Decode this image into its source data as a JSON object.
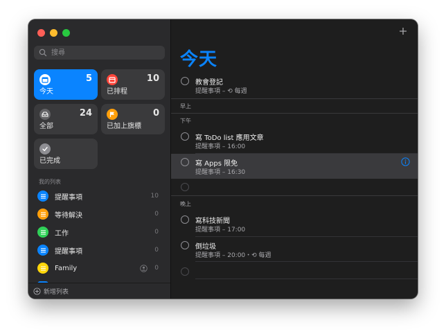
{
  "window": {
    "traffic_lights": [
      "close",
      "minimize",
      "zoom"
    ]
  },
  "sidebar": {
    "search": {
      "placeholder": "搜尋"
    },
    "smart_lists": [
      {
        "label": "今天",
        "count": "5",
        "color": "#0a84ff",
        "icon": "calendar-today-icon",
        "active": true
      },
      {
        "label": "已排程",
        "count": "10",
        "color": "#ff453a",
        "icon": "calendar-icon",
        "active": false
      },
      {
        "label": "全部",
        "count": "24",
        "color": "#636366",
        "icon": "tray-icon",
        "active": false
      },
      {
        "label": "已加上旗標",
        "count": "0",
        "color": "#ff9f0a",
        "icon": "flag-icon",
        "active": false
      },
      {
        "label": "已完成",
        "count": "",
        "color": "#8e8e93",
        "icon": "checkmark-icon",
        "active": false
      }
    ],
    "my_lists_label": "我的列表",
    "lists": [
      {
        "name": "提醒事項",
        "count": "10",
        "color": "#0a84ff",
        "icon": "list-bullet-icon"
      },
      {
        "name": "等待解決",
        "count": "0",
        "color": "#ff9f0a",
        "icon": "list-bullet-icon"
      },
      {
        "name": "工作",
        "count": "0",
        "color": "#30d158",
        "icon": "list-bullet-icon"
      },
      {
        "name": "提醒事項",
        "count": "0",
        "color": "#0a84ff",
        "icon": "list-bullet-icon"
      },
      {
        "name": "Family",
        "count": "0",
        "color": "#ffd60a",
        "icon": "list-bullet-icon",
        "shared": true
      }
    ],
    "add_list_label": "新增列表"
  },
  "main": {
    "title": "今天",
    "add_icon": "plus-icon",
    "items_top": [
      {
        "title": "教會登記",
        "subtitle": "提醒事項 – ⟲ 每週"
      }
    ],
    "groups": {
      "morning": "早上",
      "afternoon": "下午",
      "evening": "晚上"
    },
    "afternoon_items": [
      {
        "title": "寫 ToDo list 應用文章",
        "subtitle": "提醒事項 – 16:00"
      },
      {
        "title": "寫 Apps 限免",
        "subtitle": "提醒事項 – 16:30"
      }
    ],
    "evening_items": [
      {
        "title": "寫科技新聞",
        "subtitle": "提醒事項 – 17:00"
      },
      {
        "title": "倒垃圾",
        "subtitle": "提醒事項 – 20:00・⟲ 每週"
      }
    ]
  }
}
